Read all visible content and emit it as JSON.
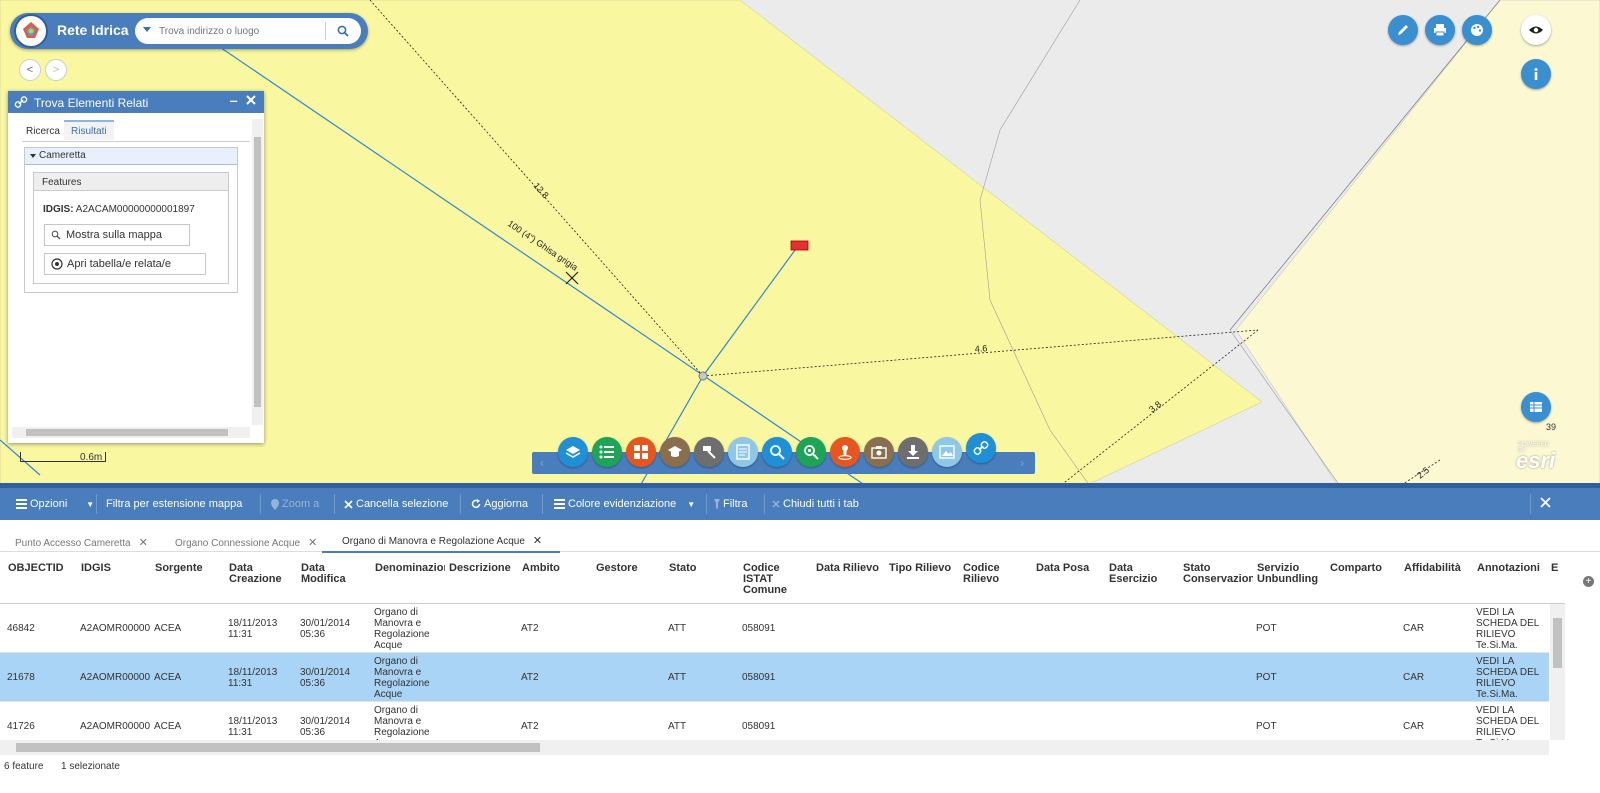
{
  "app": {
    "title": "Rete Idrica",
    "search_placeholder": "Trova indirizzo o luogo",
    "nav_back": "<",
    "nav_forward": ">"
  },
  "map": {
    "labels": {
      "pipe_main": "100 (4\") Ghisa grigia",
      "dist_1": "12.8",
      "dist_2": "4.6",
      "dist_3": "3.8",
      "dist_4": "2.5"
    },
    "scale_label": "0.6m",
    "esri_label": "esri",
    "esri_powered": "POWERED BY",
    "table_count": "39",
    "colors": {
      "parcel_yellow": "#f9f7a0",
      "parcel_light": "#fbf8d2",
      "background": "#ebebeb",
      "pipe_blue": "#2e87d8"
    }
  },
  "widget": {
    "title": "Trova Elementi Relati",
    "tabs": [
      "Ricerca",
      "Risultati"
    ],
    "active_tab": "Risultati",
    "section_title": "Cameretta",
    "features_title": "Features",
    "idgis_label": "IDGIS:",
    "idgis_value": "A2ACAM00000000001897",
    "show_on_map": "Mostra sulla mappa",
    "open_related": "Apri tabella/e relata/e"
  },
  "toolbar_icons": [
    "layers-icon",
    "legend-icon",
    "basemap-icon",
    "analysis-icon",
    "measure-icon",
    "query-icon",
    "search-icon",
    "zoom-search-icon",
    "locate-icon",
    "gallery-icon",
    "download-icon",
    "photo-icon",
    "related-link-icon"
  ],
  "attribute_table": {
    "toolbar": {
      "options": "Opzioni",
      "filter_extent": "Filtra per estensione mappa",
      "zoom_to": "Zoom a",
      "clear_selection": "Cancella selezione",
      "refresh": "Aggiorna",
      "highlight_color": "Colore evidenziazione",
      "filter": "Filtra",
      "close_all_tabs": "Chiudi tutti i tab"
    },
    "tabs": [
      "Punto Accesso Cameretta",
      "Organo Connessione Acque",
      "Organo di Manovra e Regolazione Acque"
    ],
    "active_tab": "Organo di Manovra e Regolazione Acque",
    "columns": [
      "OBJECTID",
      "IDGIS",
      "Sorgente",
      "Data\nCreazione",
      "Data\nModifica",
      "Denominazione",
      "Descrizione",
      "Ambito",
      "Gestore",
      "Stato",
      "Codice\nISTAT\nComune",
      "Data Rilievo",
      "Tipo Rilievo",
      "Codice\nRilievo",
      "Data Posa",
      "Data\nEsercizio",
      "Stato\nConservazione",
      "Servizio\nUnbundling",
      "Comparto",
      "Affidabilità",
      "Annotazioni",
      "E"
    ],
    "rows": [
      [
        "46842",
        "A2AOMR00000",
        "ACEA",
        "18/11/2013\n11:31",
        "30/01/2014\n05:36",
        "Organo di\nManovra e\nRegolazione\nAcque",
        "",
        "AT2",
        "",
        "ATT",
        "058091",
        "",
        "",
        "",
        "",
        "",
        "",
        "POT",
        "",
        "CAR",
        "VEDI LA\nSCHEDA DEL\nRILIEVO\nTe.Si.Ma."
      ],
      [
        "21678",
        "A2AOMR00000",
        "ACEA",
        "18/11/2013\n11:31",
        "30/01/2014\n05:36",
        "Organo di\nManovra e\nRegolazione\nAcque",
        "",
        "AT2",
        "",
        "ATT",
        "058091",
        "",
        "",
        "",
        "",
        "",
        "",
        "POT",
        "",
        "CAR",
        "VEDI LA\nSCHEDA DEL\nRILIEVO\nTe.Si.Ma."
      ],
      [
        "41726",
        "A2AOMR00000",
        "ACEA",
        "18/11/2013\n11:31",
        "30/01/2014\n05:36",
        "Organo di\nManovra e\nRegolazione\nAcque",
        "",
        "AT2",
        "",
        "ATT",
        "058091",
        "",
        "",
        "",
        "",
        "",
        "",
        "POT",
        "",
        "CAR",
        "VEDI LA\nSCHEDA DEL\nRILIEVO\nTe.Si.Ma."
      ]
    ],
    "selected_row": 1,
    "footer_count": "6 feature",
    "footer_selected": "1 selezionate"
  }
}
